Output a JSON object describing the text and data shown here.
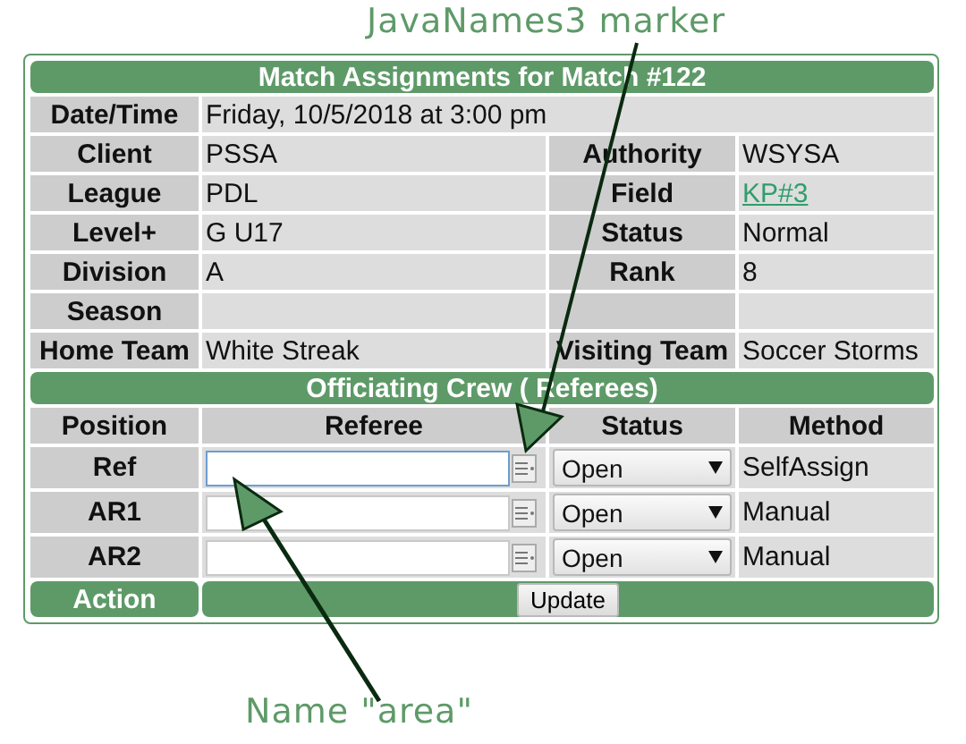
{
  "annotations": [
    {
      "text": "JavaNames3 marker"
    },
    {
      "text": "Name \"area\""
    }
  ],
  "match": {
    "title": "Match Assignments for Match #122",
    "rows": [
      {
        "kind": "wide",
        "label": "Date/Time",
        "value": "Friday, 10/5/2018 at 3:00 pm"
      },
      {
        "kind": "pair",
        "label": "Client",
        "value": "PSSA",
        "right": {
          "label": "Authority",
          "value": "WSYSA",
          "link": false
        }
      },
      {
        "kind": "pair",
        "label": "League",
        "value": "PDL",
        "right": {
          "label": "Field",
          "value": "KP#3",
          "link": true
        }
      },
      {
        "kind": "pair",
        "label": "Level+",
        "value": "G U17",
        "right": {
          "label": "Status",
          "value": "Normal",
          "link": false
        }
      },
      {
        "kind": "pair",
        "label": "Division",
        "value": "A",
        "right": {
          "label": "Rank",
          "value": "8",
          "link": false
        }
      },
      {
        "kind": "pair",
        "label": "Season"
      },
      {
        "kind": "pair",
        "label": "Home Team",
        "value": "White Streak",
        "right": {
          "label": "Visiting Team",
          "value": "Soccer Storms",
          "link": false
        }
      }
    ]
  },
  "crew": {
    "title": "Officiating Crew ( Referees)",
    "columns": [
      "Position",
      "Referee",
      "Status",
      "Method"
    ],
    "rows": [
      {
        "position": "Ref",
        "focused": true,
        "status": "Open",
        "method": "SelfAssign"
      },
      {
        "position": "AR1",
        "focused": false,
        "status": "Open",
        "method": "Manual"
      },
      {
        "position": "AR2",
        "focused": false,
        "status": "Open",
        "method": "Manual"
      }
    ],
    "action": {
      "label": "Action",
      "button": "Update"
    }
  }
}
